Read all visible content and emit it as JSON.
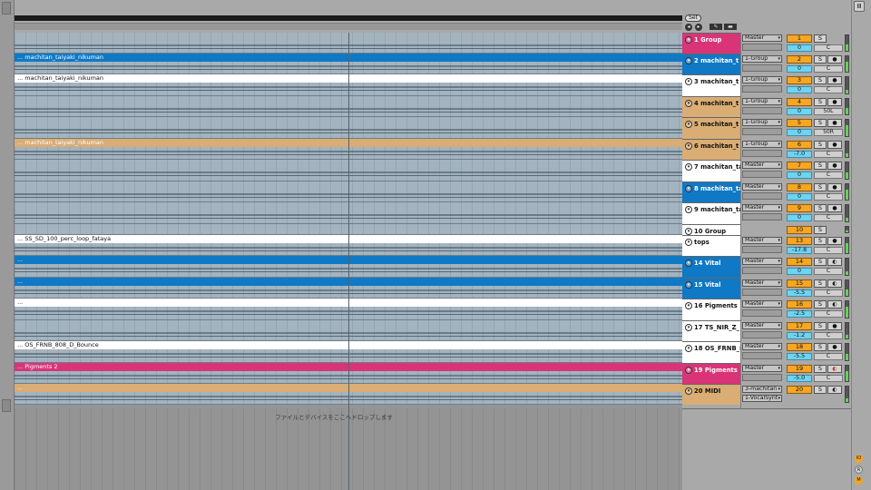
{
  "header": {
    "set_label": "Set",
    "nav_back": "◂",
    "nav_fwd": "▸",
    "tool1": "✎",
    "tool2": "▬"
  },
  "arrangement": {
    "drop_hint": "ファイルとデバイスをここへドロップします",
    "clips": [
      {
        "label": "... machitan_taiyaki_nikuman",
        "color": "#0f79c5"
      },
      {
        "label": "... machitan_taiyaki_nikuman",
        "color": "#ffffff"
      },
      {
        "label": "... machitan_taiyaki_nikuman",
        "color": "#d9ad74"
      },
      {
        "label": "... SS_SD_100_perc_loop_fataya",
        "color": "#ffffff"
      },
      {
        "label": "...",
        "color": "#0f79c5"
      },
      {
        "label": "...",
        "color": "#0f79c5"
      },
      {
        "label": "...",
        "color": "#ffffff"
      },
      {
        "label": "... OS_FRNB_808_D_Bounce",
        "color": "#ffffff"
      },
      {
        "label": "... Pigments 2",
        "color": "#d93478"
      },
      {
        "label": "...",
        "color": "#d9ad74"
      }
    ]
  },
  "tracks": [
    {
      "name": "1 Group",
      "color": "#d93478",
      "route": "Master",
      "num": "1",
      "vol": "0",
      "pan": "C",
      "solo": "S",
      "arm": ""
    },
    {
      "name": "2 machitan_t",
      "color": "#0f79c5",
      "route": "1-Group",
      "num": "2",
      "vol": "0",
      "pan": "C",
      "solo": "S",
      "arm": "●"
    },
    {
      "name": "3 machitan_t",
      "color": "#ffffff",
      "route": "1-Group",
      "num": "3",
      "vol": "0",
      "pan": "C",
      "solo": "S",
      "arm": "●"
    },
    {
      "name": "4 machitan_t",
      "color": "#d9ad74",
      "route": "1-Group",
      "num": "4",
      "vol": "0",
      "pan": "50L",
      "solo": "S",
      "arm": "●"
    },
    {
      "name": "5 machitan_t",
      "color": "#d9ad74",
      "route": "1-Group",
      "num": "5",
      "vol": "0",
      "pan": "50R",
      "solo": "S",
      "arm": "●"
    },
    {
      "name": "6 machitan_t",
      "color": "#d9ad74",
      "route": "1-Group",
      "num": "6",
      "vol": "-7.0",
      "pan": "C",
      "solo": "S",
      "arm": "●"
    },
    {
      "name": "7 machitan_ta",
      "color": "#ffffff",
      "route": "Master",
      "num": "7",
      "vol": "0",
      "pan": "C",
      "solo": "S",
      "arm": "●"
    },
    {
      "name": "8 machitan_ta",
      "color": "#0f79c5",
      "route": "Master",
      "num": "8",
      "vol": "0",
      "pan": "C",
      "solo": "S",
      "arm": "●"
    },
    {
      "name": "9 machitan_ta",
      "color": "#ffffff",
      "route": "Master",
      "num": "9",
      "vol": "0",
      "pan": "C",
      "solo": "S",
      "arm": "●"
    },
    {
      "name": "10 Group",
      "color": "#ffffff",
      "route": "",
      "num": "10",
      "vol": "",
      "pan": "",
      "solo": "S",
      "arm": ""
    },
    {
      "name": "tops",
      "color": "#ffffff",
      "route": "Master",
      "num": "13",
      "vol": "-17.8",
      "pan": "C",
      "solo": "S",
      "arm": "●"
    },
    {
      "name": "14 Vital",
      "color": "#0f79c5",
      "route": "Master",
      "num": "14",
      "vol": "0",
      "pan": "C",
      "solo": "S",
      "arm": "◐"
    },
    {
      "name": "15 Vital",
      "color": "#0f79c5",
      "route": "Master",
      "num": "15",
      "vol": "-5.5",
      "pan": "C",
      "solo": "S",
      "arm": "◐"
    },
    {
      "name": "16 Pigments",
      "color": "#ffffff",
      "route": "Master",
      "num": "16",
      "vol": "-2.5",
      "pan": "C",
      "solo": "S",
      "arm": "◐"
    },
    {
      "name": "17 TS_NIR_Z_",
      "color": "#ffffff",
      "route": "Master",
      "num": "17",
      "vol": "-1.2",
      "pan": "C",
      "solo": "S",
      "arm": "●"
    },
    {
      "name": "18 OS_FRNB_8",
      "color": "#ffffff",
      "route": "Master",
      "num": "18",
      "vol": "-5.5",
      "pan": "C",
      "solo": "S",
      "arm": "●"
    },
    {
      "name": "19 Pigments",
      "color": "#d93478",
      "route": "Master",
      "num": "19",
      "vol": "-5.0",
      "pan": "C",
      "solo": "S",
      "arm": "◐"
    },
    {
      "name": "20 MIDI",
      "color": "#d9ad74",
      "route": "3-machitan",
      "route2": "1-VocalSynt",
      "num": "20",
      "vol": "",
      "pan": "",
      "solo": "S",
      "arm": "◐"
    }
  ],
  "right_strip": {
    "top_button": "Ⅲ",
    "badge1": "IO",
    "badge2": "R",
    "badge3": "M"
  }
}
